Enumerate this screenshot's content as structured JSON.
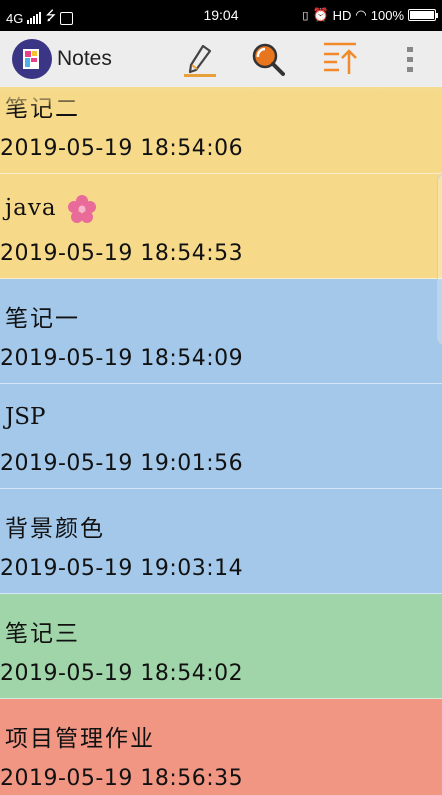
{
  "status_bar": {
    "network": "4G",
    "time": "19:04",
    "hd_label": "HD",
    "battery_percent": "100%",
    "battery_level": 1.0
  },
  "app_bar": {
    "title": "Notes",
    "actions": [
      {
        "name": "new-note-button",
        "icon": "pencil-icon"
      },
      {
        "name": "search-button",
        "icon": "search-icon"
      },
      {
        "name": "sort-button",
        "icon": "sort-icon"
      },
      {
        "name": "more-options-button",
        "icon": "more-vert-icon"
      }
    ],
    "colors": {
      "edit": "#e8a03a",
      "search": "#e8761f",
      "sort": "#f08a2a"
    }
  },
  "notes": [
    {
      "title": "笔记二",
      "date": "2019-05-19 18:54:06",
      "color": "#f6da8a"
    },
    {
      "title": "java",
      "date": "2019-05-19 18:54:53",
      "color": "#f6da8a",
      "icon": "flower-icon"
    },
    {
      "title": "笔记一",
      "date": "2019-05-19 18:54:09",
      "color": "#a3c8ea"
    },
    {
      "title": "JSP",
      "date": "2019-05-19 19:01:56",
      "color": "#a3c8ea"
    },
    {
      "title": "背景颜色",
      "date": "2019-05-19 19:03:14",
      "color": "#a3c8ea"
    },
    {
      "title": "笔记三",
      "date": "2019-05-19 18:54:02",
      "color": "#a0d5aa"
    },
    {
      "title": "项目管理作业",
      "date": "2019-05-19 18:56:35",
      "color": "#f29684"
    }
  ]
}
